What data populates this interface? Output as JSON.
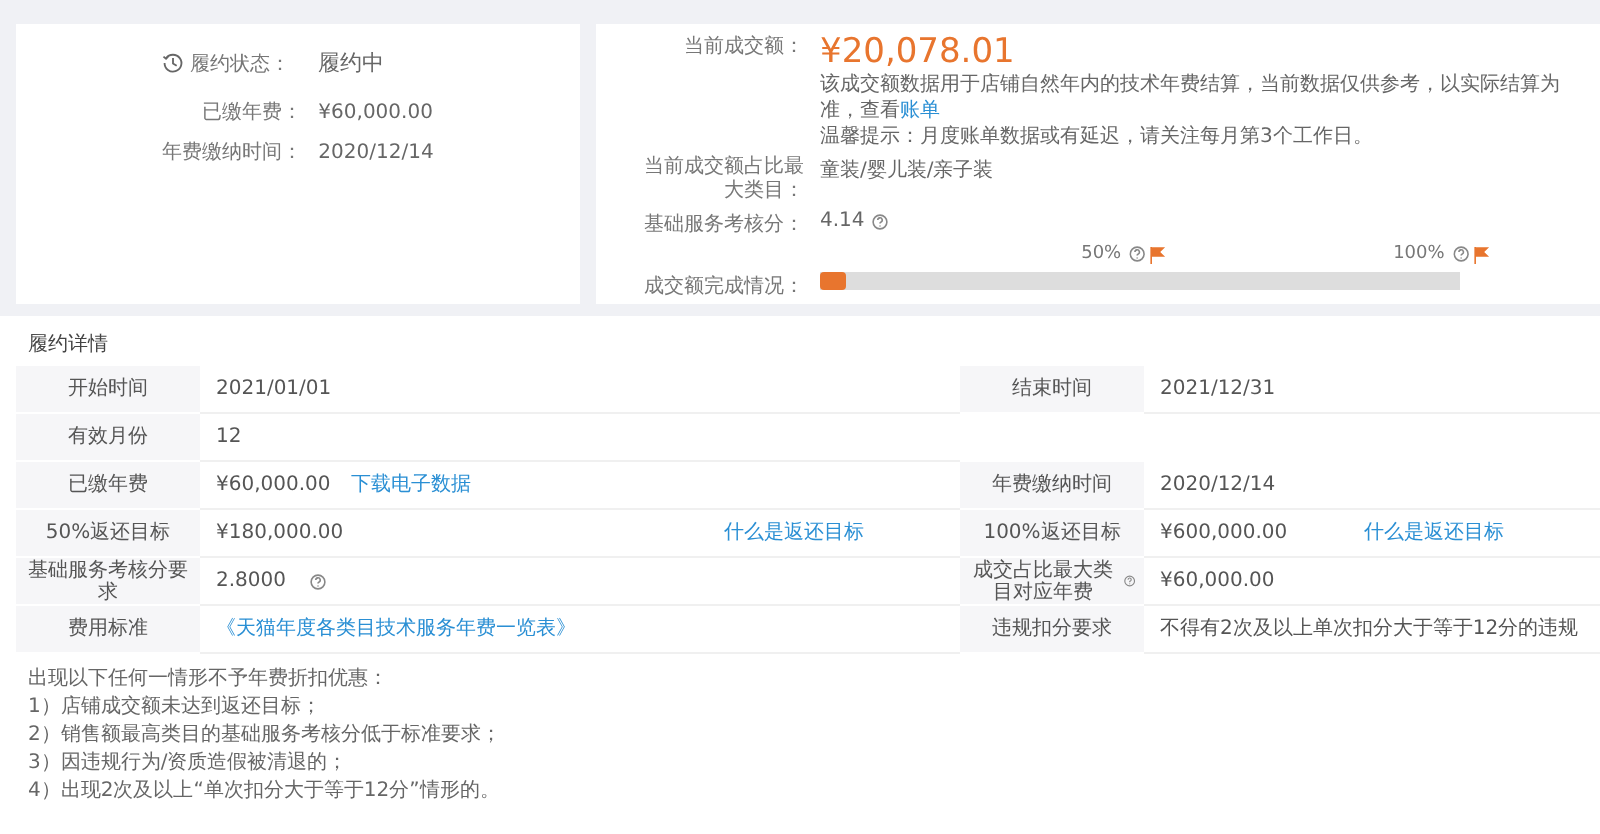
{
  "status_card": {
    "status_label": "履约状态：",
    "status": "履约中",
    "fields": [
      {
        "label": "已缴年费：",
        "value": "¥60,000.00"
      },
      {
        "label": "年费缴纳时间：",
        "value": "2020/12/14"
      }
    ]
  },
  "sales_card": {
    "amount_label": "当前成交额：",
    "amount": "¥20,078.01",
    "note": "该成交额数据用于店铺自然年内的技术年费结算，当前数据仅供参考，以实际结算为准，查看",
    "note_link": "账单",
    "tip": "温馨提示：月度账单数据或有延迟，请关注每月第3个工作日。",
    "category_label": "当前成交额占比最大类目：",
    "category": "童装/婴儿装/亲子装",
    "score_label": "基础服务考核分：",
    "score": "4.14",
    "progress": {
      "label": "成交额完成情况：",
      "level": 0.04,
      "markers": [
        "50%",
        "100%"
      ]
    }
  },
  "details": {
    "title": "履约详情",
    "rows": [
      {
        "cells": [
          {
            "label": "开始时间",
            "value": "2021/01/01",
            "kind": "text"
          },
          {
            "label": "结束时间",
            "value": "2021/12/31",
            "kind": "text"
          }
        ]
      },
      {
        "cells": [
          {
            "label": "有效月份",
            "value": "12",
            "kind": "text"
          }
        ]
      },
      {
        "cells": [
          {
            "label": "已缴年费",
            "value": "¥60,000.00",
            "kind": "text",
            "link": "下载电子数据"
          },
          {
            "label": "年费缴纳时间",
            "value": "2020/12/14",
            "kind": "text"
          }
        ]
      },
      {
        "cells": [
          {
            "label": "50%返还目标",
            "value": "¥180,000.00",
            "kind": "text",
            "side_link": "什么是返还目标"
          },
          {
            "label": "100%返还目标",
            "value": "¥600,000.00",
            "kind": "text",
            "side_link": "什么是返还目标"
          }
        ]
      },
      {
        "cells": [
          {
            "label": "基础服务考核分要求",
            "value": "2.8000",
            "kind": "text",
            "value_help": true
          },
          {
            "label": "成交占比最大类目对应年费",
            "label_help": true,
            "value": "¥60,000.00",
            "kind": "text"
          }
        ]
      },
      {
        "cells": [
          {
            "label": "费用标准",
            "value": "《天猫年度各类目技术服务年费一览表》",
            "kind": "link"
          },
          {
            "label": "违规扣分要求",
            "value": "不得有2次及以上单次扣分大于等于12分的违规",
            "kind": "text"
          }
        ]
      }
    ],
    "notes": [
      "出现以下任何一情形不予年费折扣优惠：",
      "1）店铺成交额未达到返还目标；",
      "2）销售额最高类目的基础服务考核分低于标准要求；",
      "3）因违规行为/资质造假被清退的；",
      "4）出现2次及以上“单次扣分大于等于12分”情形的。"
    ]
  }
}
